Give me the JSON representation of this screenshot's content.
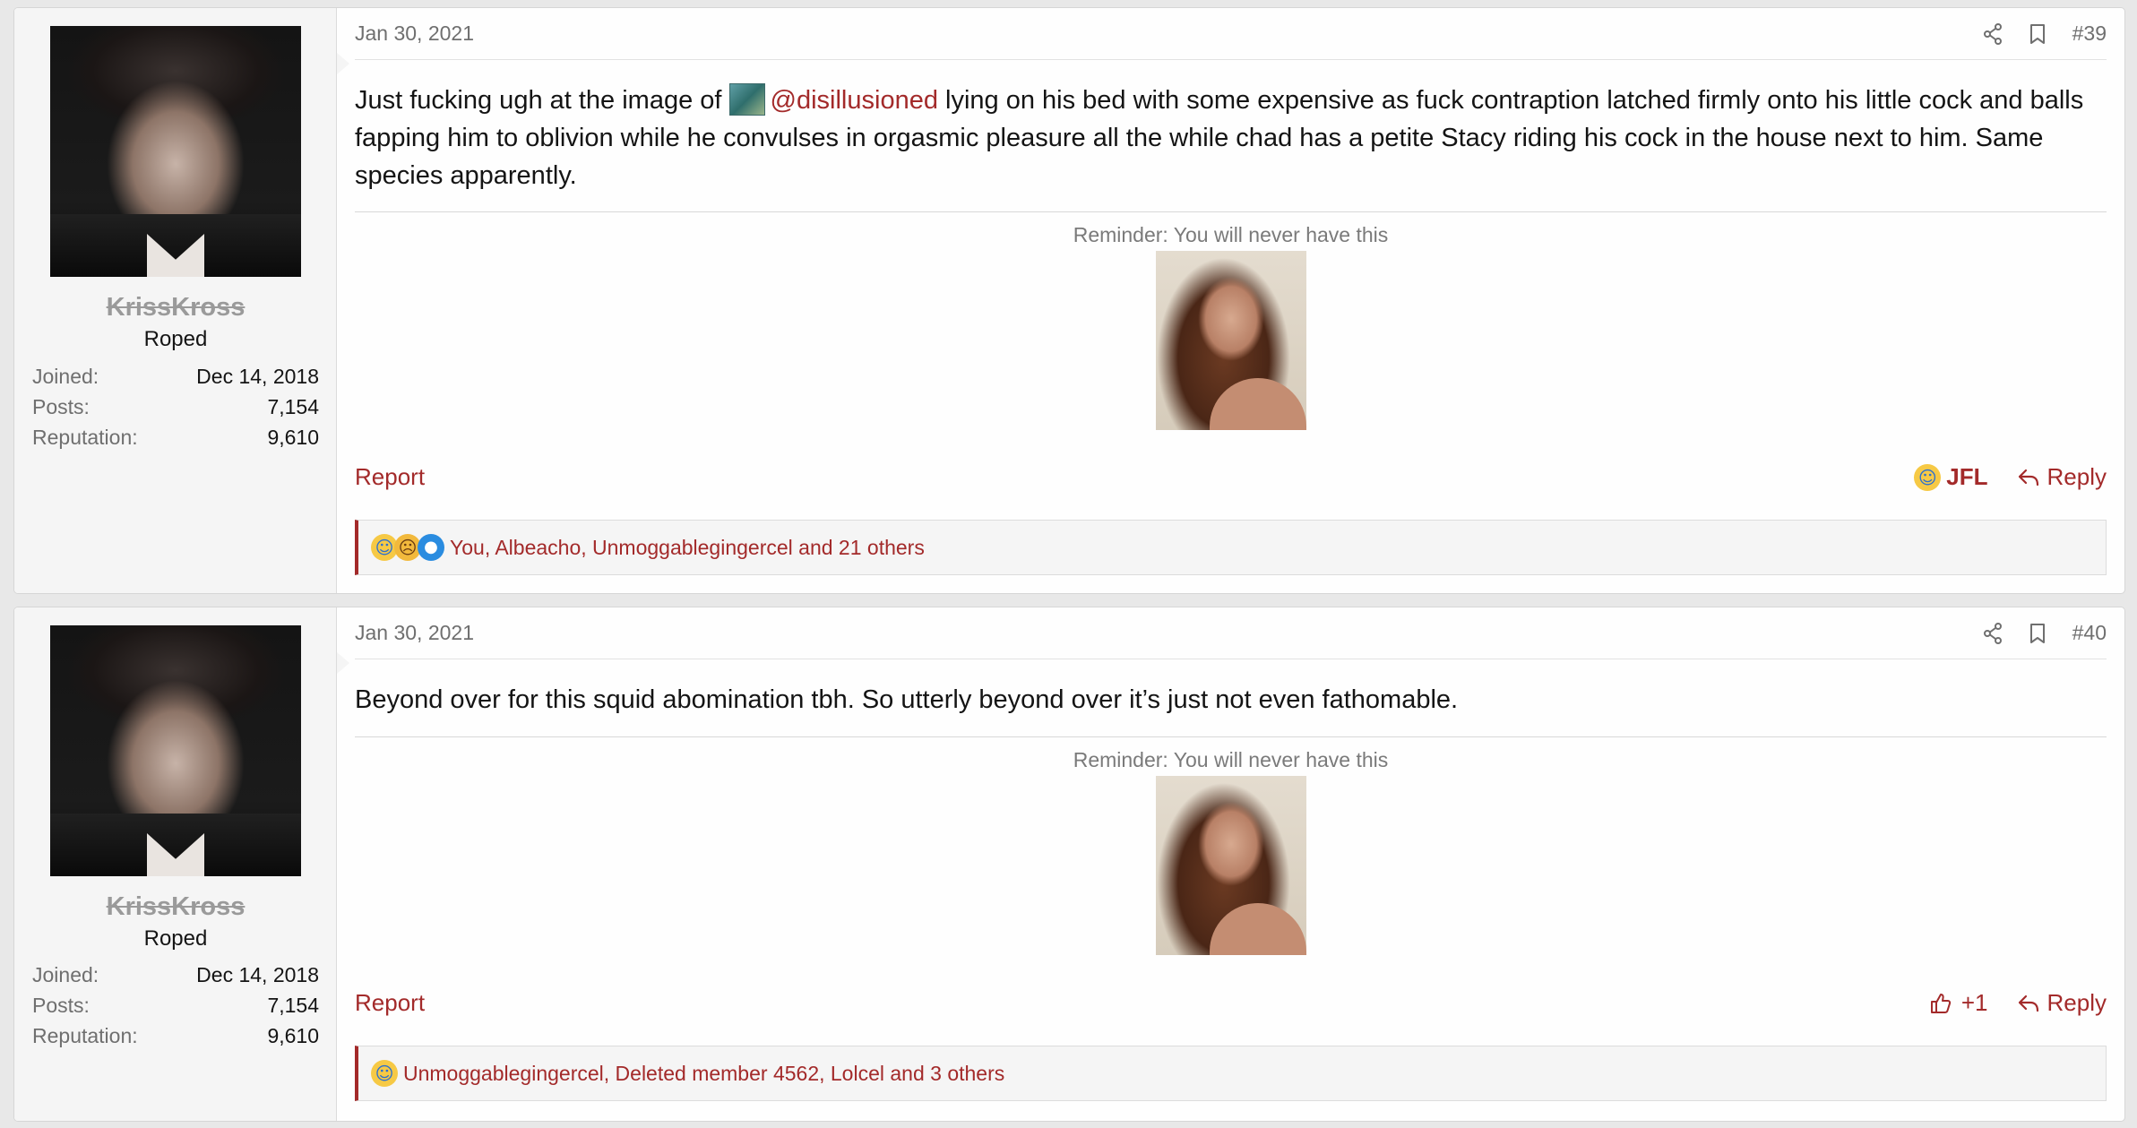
{
  "posts": [
    {
      "user": {
        "name": "KrissKross",
        "title": "Roped",
        "joined_label": "Joined:",
        "joined": "Dec 14, 2018",
        "posts_label": "Posts:",
        "posts": "7,154",
        "reputation_label": "Reputation:",
        "reputation": "9,610"
      },
      "date": "Jan 30, 2021",
      "number": "#39",
      "body_before": "Just fucking ugh at the image of ",
      "mention": "@disillusioned",
      "body_after": " lying on his bed with some expensive as fuck contraption latched firmly onto his little cock and balls fapping him to oblivion while he convulses in orgasmic pleasure all the while chad has a petite Stacy riding his cock in the house next to him. Same species apparently.",
      "signature": "Reminder: You will never have this",
      "report": "Report",
      "reaction_button": "JFL",
      "reply": "Reply",
      "reactions_summary": "You, Albeacho, Unmoggablegingercel and 21 others"
    },
    {
      "user": {
        "name": "KrissKross",
        "title": "Roped",
        "joined_label": "Joined:",
        "joined": "Dec 14, 2018",
        "posts_label": "Posts:",
        "posts": "7,154",
        "reputation_label": "Reputation:",
        "reputation": "9,610"
      },
      "date": "Jan 30, 2021",
      "number": "#40",
      "body": "Beyond over for this squid abomination tbh. So utterly beyond over it’s just not even fathomable.",
      "signature": "Reminder: You will never have this",
      "report": "Report",
      "reaction_button": "+1",
      "reply": "Reply",
      "reactions_summary": "Unmoggablegingercel, Deleted member 4562, Lolcel and 3 others"
    }
  ],
  "colors": {
    "accent": "#a32a2a",
    "muted": "#6f6f6f",
    "panel": "#f5f5f5"
  },
  "icons": [
    "share-icon",
    "bookmark-icon",
    "reply-icon",
    "thumbs-up-icon",
    "laughing-emoji-icon",
    "sad-emoji-icon",
    "crying-emoji-icon"
  ]
}
